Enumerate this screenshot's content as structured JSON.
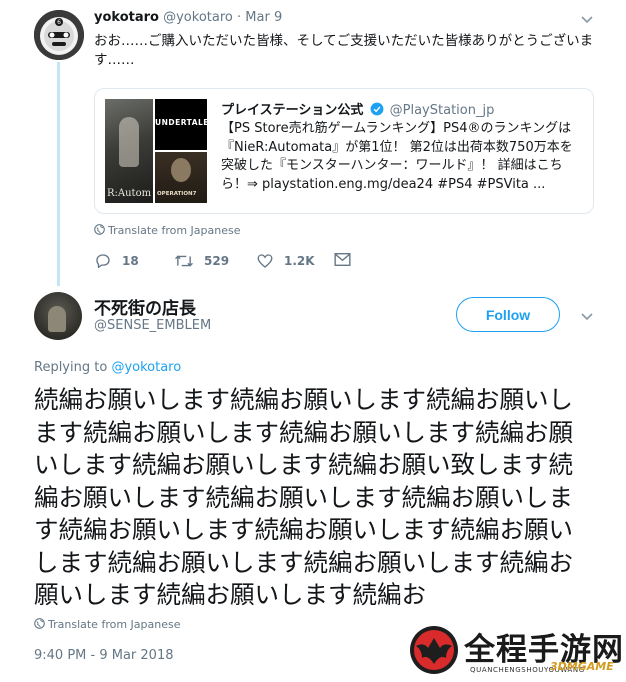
{
  "parent_tweet": {
    "display_name": "yokotaro",
    "handle": "@yokotaro",
    "separator": "·",
    "date": "Mar 9",
    "text": "おお……ご購入いただいた皆様、そしてご支援いただいた皆様ありがとうございます……",
    "quoted": {
      "display_name": "プレイステーション公式",
      "handle": "@PlayStation_jp",
      "text": "【PS Store売れ筋ゲームランキング】PS4®のランキングは『NieR:Automata』が第1位！ 第2位は出荷本数750万本を突破した『モンスターハンター：ワールド』！ 詳細はこちら！⇒ playstation.eng.mg/dea24 #PS4 #PSVita ...",
      "image_labels": {
        "nier": "R:Autom",
        "undertale": "UNDERTALE",
        "operation7": "OPERATION7"
      }
    },
    "translate_label": "Translate from Japanese",
    "actions": {
      "replies": "18",
      "retweets": "529",
      "likes": "1.2K"
    }
  },
  "main_tweet": {
    "display_name": "不死街の店長",
    "handle": "@SENSE_EMBLEM",
    "follow_label": "Follow",
    "replying_prefix": "Replying to",
    "replying_to": "@yokotaro",
    "text": "続編お願いします続編お願いします続編お願いします続編お願いします続編お願いします続編お願いします続編お願いします続編お願い致します続編お願いします続編お願いします続編お願いします続編お願いします続編お願いします続編お願いします続編お願いします続編お願いします続編お願いします続編お願いします続編お",
    "translate_label": "Translate from Japanese",
    "timestamp": "9:40 PM - 9 Mar 2018"
  },
  "watermark": {
    "title": "全程手游网",
    "subtitle": "QUANCHENGSHOUYOUWANG",
    "badge": "3DMGAME"
  },
  "colors": {
    "accent": "#1da1f2",
    "thread_line": "#c4e4f8",
    "secondary_text": "#657786",
    "border": "#e1e8ed"
  },
  "icons": {
    "reply": "reply-icon",
    "retweet": "retweet-icon",
    "like": "heart-icon",
    "dm": "envelope-icon",
    "verified": "verified-badge-icon",
    "globe": "globe-icon",
    "caret": "chevron-down-icon"
  }
}
